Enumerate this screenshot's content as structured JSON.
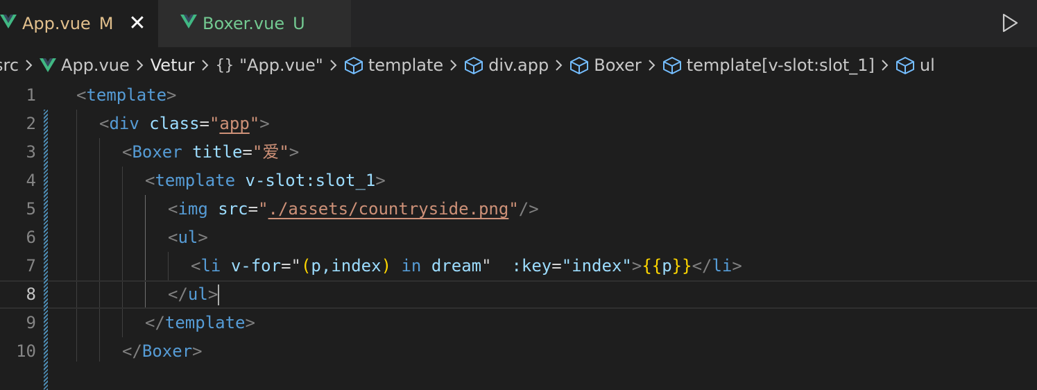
{
  "tabs": [
    {
      "name": "App.vue",
      "status": "M",
      "active": true,
      "close": "✕"
    },
    {
      "name": "Boxer.vue",
      "status": "U",
      "active": false
    }
  ],
  "breadcrumb": {
    "items": [
      "src",
      "App.vue",
      "Vetur",
      "\"App.vue\"",
      "template",
      "div.app",
      "Boxer",
      "template[v-slot:slot_1]",
      "ul"
    ],
    "curly_glyph": "{}"
  },
  "editor": {
    "line_numbers": [
      "1",
      "2",
      "3",
      "4",
      "5",
      "6",
      "7",
      "8",
      "9",
      "10"
    ],
    "current_line": "8",
    "code": {
      "l1": {
        "open": "<",
        "tag": "template",
        "close": ">"
      },
      "l2": {
        "open": "<",
        "tag": "div",
        "attr": "class",
        "eq": "=",
        "q1": "\"",
        "val": "app",
        "q2": "\"",
        "close": ">"
      },
      "l3": {
        "open": "<",
        "tag": "Boxer",
        "attr": "title",
        "eq": "=",
        "q1": "\"",
        "val": "爱",
        "q2": "\"",
        "close": ">"
      },
      "l4": {
        "open": "<",
        "tag": "template",
        "attr": "v-slot:slot_1",
        "close": ">"
      },
      "l5": {
        "open": "<",
        "tag": "img",
        "attr": "src",
        "eq": "=",
        "q1": "\"",
        "val": "./assets/countryside.png",
        "q2": "\"",
        "close": "/>"
      },
      "l6": {
        "open": "<",
        "tag": "ul",
        "close": ">"
      },
      "l7": {
        "open": "<",
        "tag": "li",
        "attr": "v-for",
        "eq": "=",
        "q1": "\"",
        "p_open": "(",
        "args": "p,index",
        "p_close": ")",
        "kw_in": "in",
        "iter": "dream",
        "q2": "\"",
        "key_attr": ":key",
        "eq2": "=",
        "key_val": "\"index\"",
        "close": ">",
        "mustache_open": "{{",
        "var": "p",
        "mustache_close": "}}",
        "end_open": "</",
        "end_tag": "li",
        "end_close": ">"
      },
      "l8": {
        "open": "</",
        "tag": "ul",
        "close": ">"
      },
      "l9": {
        "open": "</",
        "tag": "template",
        "close": ">"
      },
      "l10": {
        "open": "</",
        "tag": "Boxer",
        "close": ">"
      }
    }
  },
  "colors": {
    "modified": "#e2c08d",
    "untracked": "#73c991",
    "vue_logo_outer": "#41b883",
    "vue_logo_inner": "#35495e",
    "symbol_icon": "#75beff"
  }
}
